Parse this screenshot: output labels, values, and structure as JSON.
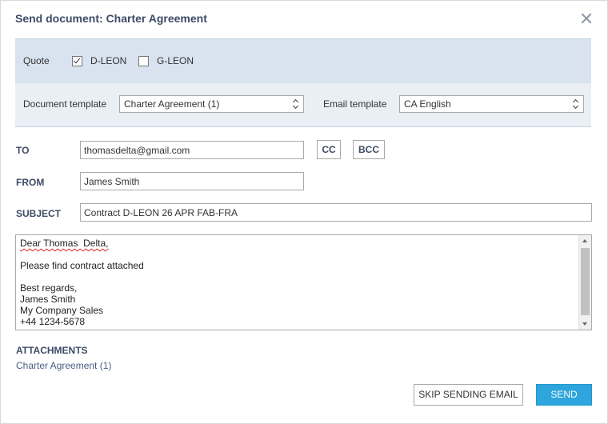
{
  "dialog": {
    "title": "Send document: Charter Agreement"
  },
  "quote": {
    "label": "Quote",
    "options": [
      {
        "label": "D-LEON",
        "checked": true
      },
      {
        "label": "G-LEON",
        "checked": false
      }
    ]
  },
  "templates": {
    "document_label": "Document template",
    "document_value": "Charter Agreement (1)",
    "email_label": "Email template",
    "email_value": "CA English"
  },
  "fields": {
    "to_label": "TO",
    "to_value": "thomasdelta@gmail.com",
    "cc_label": "CC",
    "bcc_label": "BCC",
    "from_label": "FROM",
    "from_value": "James Smith",
    "subject_label": "SUBJECT",
    "subject_value": "Contract D-LEON 26 APR FAB-FRA"
  },
  "body": {
    "lines": [
      "Dear Thomas  Delta,",
      "",
      "Please find contract attached",
      "",
      "Best regards,",
      "James Smith",
      "My Company Sales",
      "+44 1234-5678"
    ]
  },
  "attachments": {
    "title": "ATTACHMENTS",
    "items": [
      "Charter Agreement (1)"
    ]
  },
  "actions": {
    "skip_label": "SKIP SENDING EMAIL",
    "send_label": "SEND"
  },
  "colors": {
    "accent": "#2ea5dc",
    "label": "#3d4b66",
    "band_dark": "#d9e2ef",
    "band_light": "#eaeff6"
  }
}
